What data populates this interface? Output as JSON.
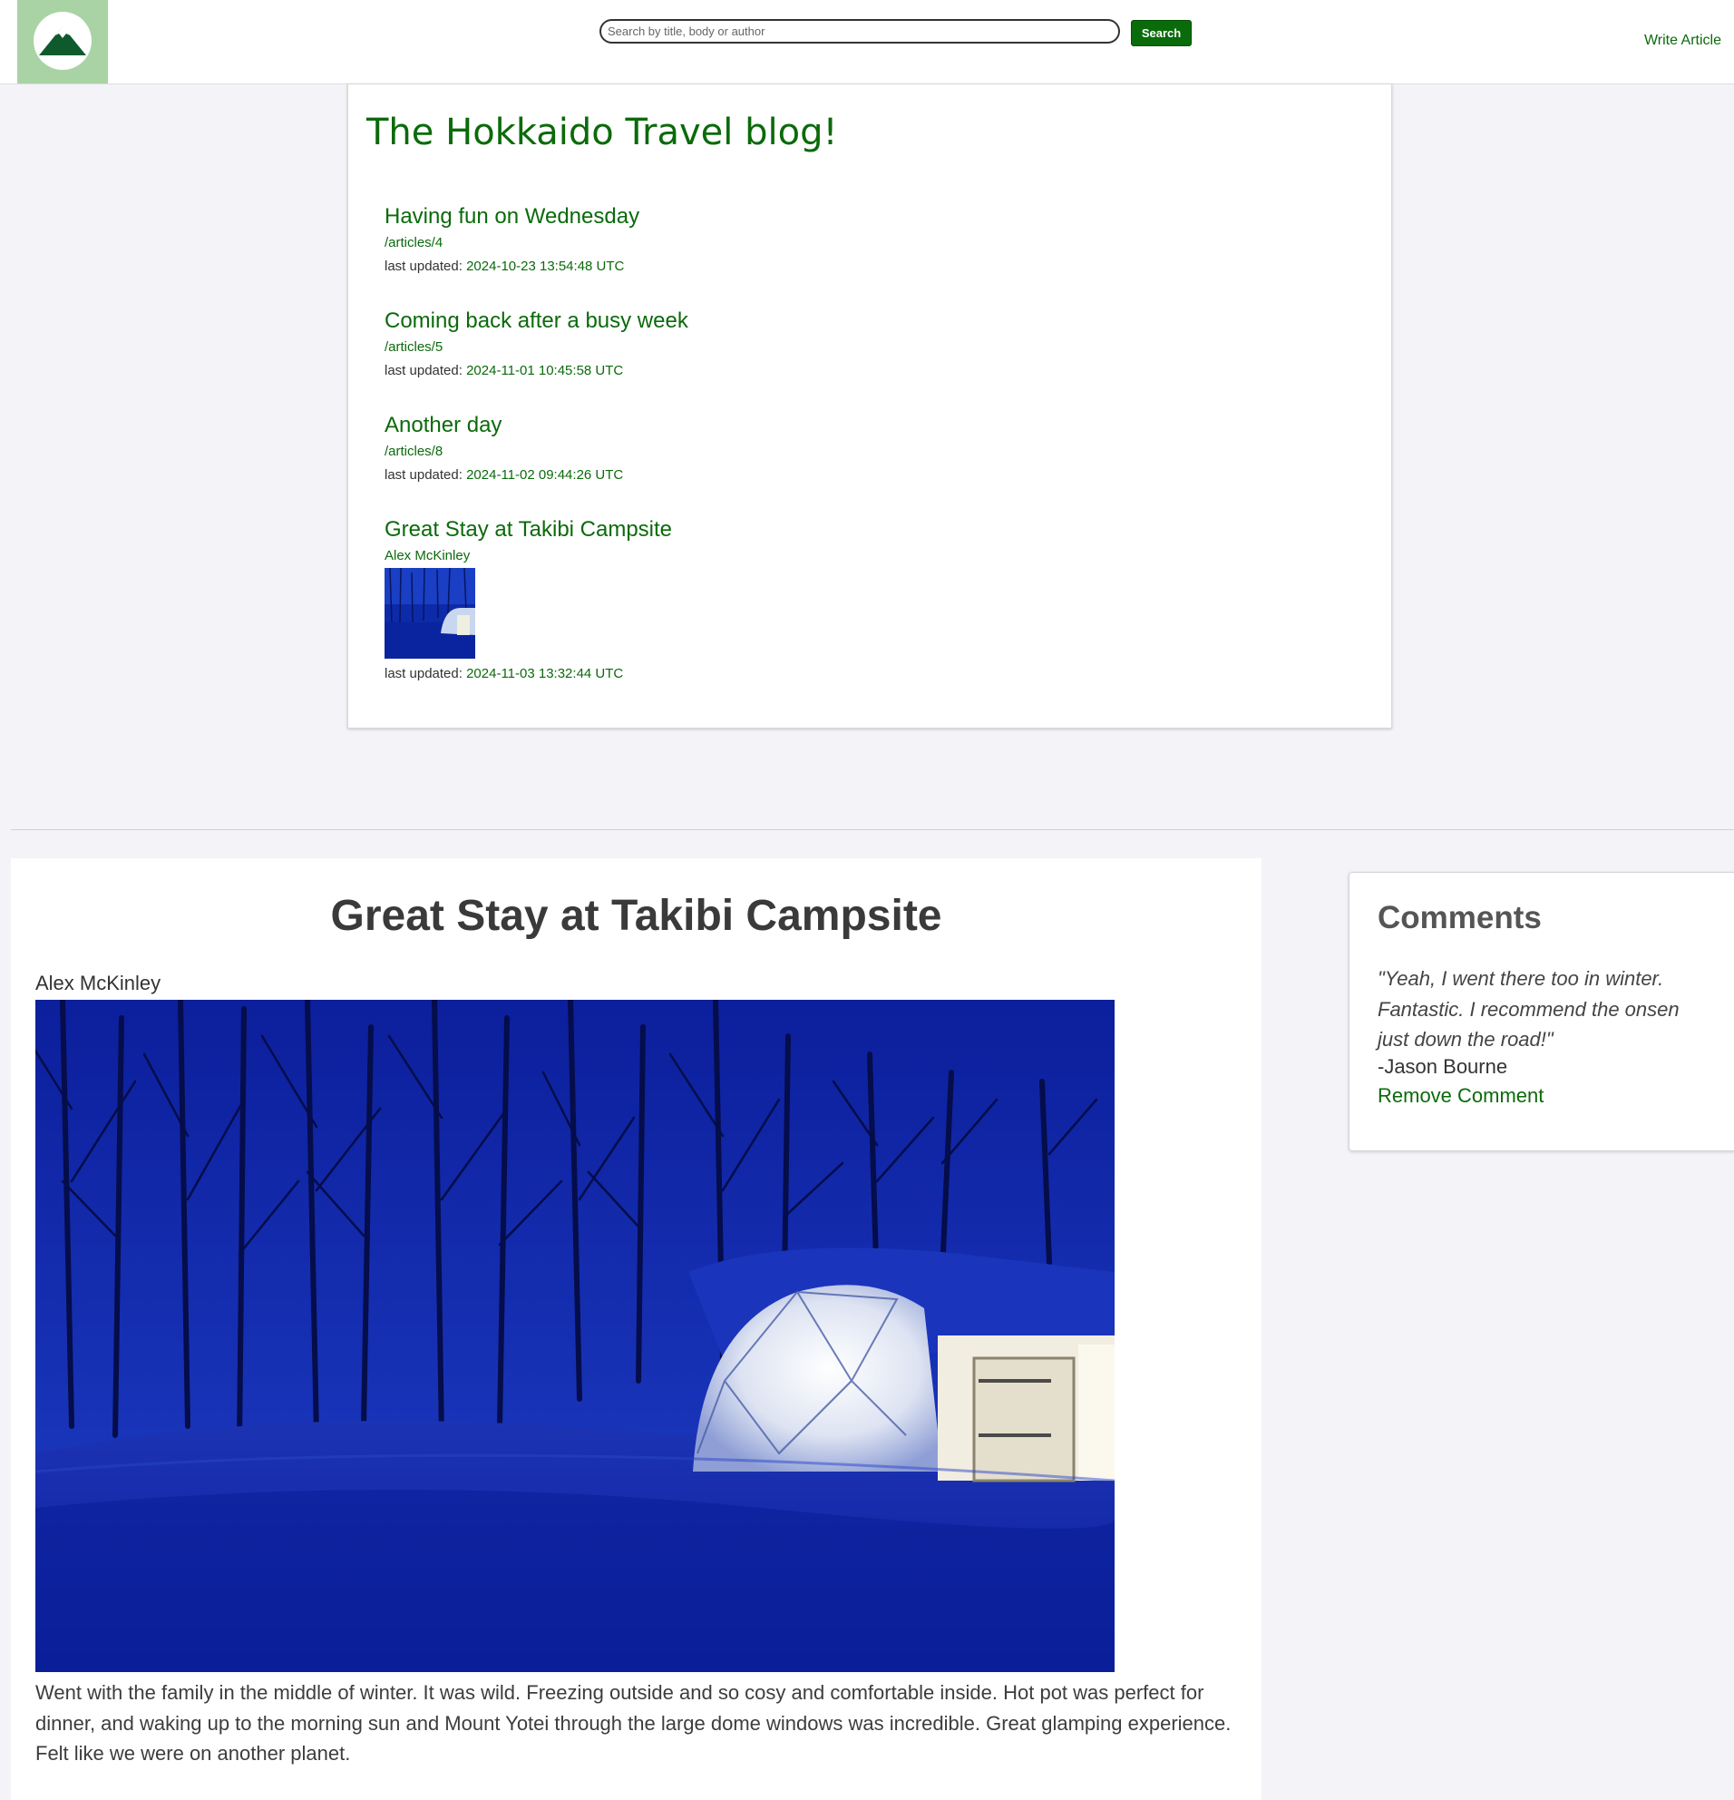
{
  "header": {
    "logo_icon": "mountain-logo-icon",
    "search_placeholder": "Search by title, body or author",
    "search_value": "",
    "search_button": "Search",
    "write_article": "Write Article"
  },
  "blog": {
    "title": "The Hokkaido Travel blog!",
    "entries": [
      {
        "title": "Having fun on Wednesday",
        "path": "/articles/4",
        "meta_label": "last updated:",
        "timestamp": "2024-10-23 13:54:48 UTC"
      },
      {
        "title": "Coming back after a busy week",
        "path": "/articles/5",
        "meta_label": "last updated:",
        "timestamp": "2024-11-01 10:45:58 UTC"
      },
      {
        "title": "Another day",
        "path": "/articles/8",
        "meta_label": "last updated:",
        "timestamp": "2024-11-02 09:44:26 UTC"
      },
      {
        "title": "Great Stay at Takibi Campsite",
        "author": "Alex McKinley",
        "meta_label": "last updated:",
        "timestamp": "2024-11-03 13:32:44 UTC"
      }
    ]
  },
  "article": {
    "title": "Great Stay at Takibi Campsite",
    "author": "Alex McKinley",
    "body": "Went with the family in the middle of winter. It was wild. Freezing outside and so cosy and comfortable inside. Hot pot was perfect for dinner, and waking up to the morning sun and Mount Yotei through the large dome windows was incredible. Great glamping experience. Felt like we were on another planet."
  },
  "comments": {
    "title": "Comments",
    "items": [
      {
        "text": "\"Yeah, I went there too in winter. Fantastic. I recommend the onsen just down the road!\"",
        "author": "-Jason Bourne",
        "remove_label": "Remove Comment"
      }
    ]
  },
  "colors": {
    "accent": "#0b6a0b",
    "logo_bg": "#a9d3a4",
    "page_bg": "#f3f3f8"
  }
}
